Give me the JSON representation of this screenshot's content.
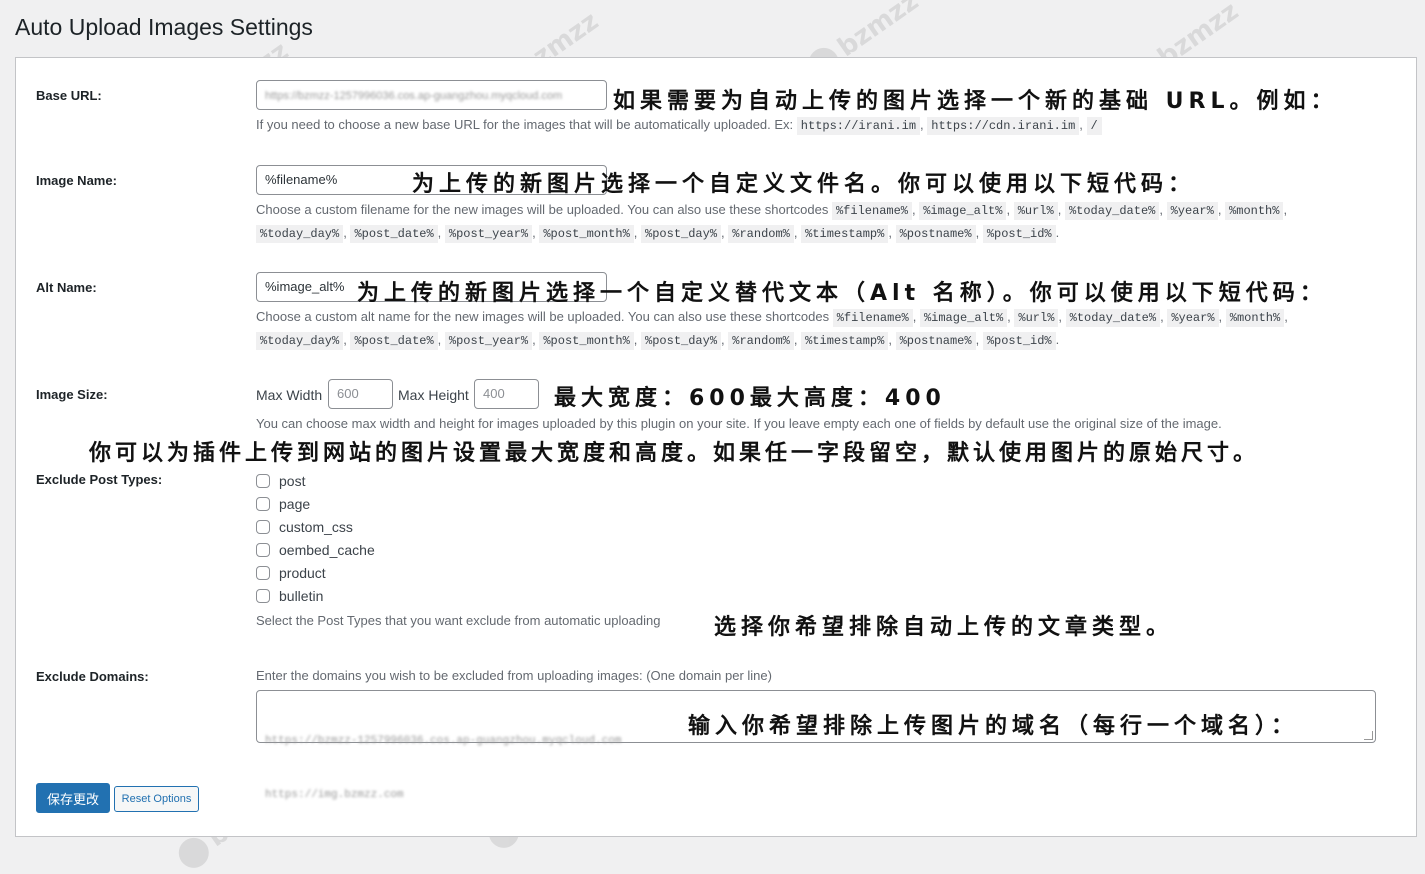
{
  "page": {
    "title": "Auto Upload Images Settings"
  },
  "base_url": {
    "label": "Base URL:",
    "value": "https://bzmzz-1257996036.cos.ap-guangzhou.myqcloud.com",
    "description": "If you need to choose a new base URL for the images that will be automatically uploaded. Ex:",
    "examples": [
      "https://irani.im",
      "https://cdn.irani.im",
      "/"
    ],
    "annotation": "如果需要为自动上传的图片选择一个新的基础 URL。例如："
  },
  "image_name": {
    "label": "Image Name:",
    "value": "%filename%",
    "description": "Choose a custom filename for the new images will be uploaded. You can also use these shortcodes",
    "annotation": "为上传的新图片选择一个自定义文件名。你可以使用以下短代码："
  },
  "alt_name": {
    "label": "Alt Name:",
    "value": "%image_alt%",
    "description": "Choose a custom alt name for the new images will be uploaded. You can also use these shortcodes",
    "annotation": "为上传的新图片选择一个自定义替代文本（Alt 名称）。你可以使用以下短代码："
  },
  "shortcodes": [
    "%filename%",
    "%image_alt%",
    "%url%",
    "%today_date%",
    "%year%",
    "%month%",
    "%today_day%",
    "%post_date%",
    "%post_year%",
    "%post_month%",
    "%post_day%",
    "%random%",
    "%timestamp%",
    "%postname%",
    "%post_id%"
  ],
  "image_size": {
    "label": "Image Size:",
    "max_width_label": "Max Width",
    "max_width_placeholder": "600",
    "max_height_label": "Max Height",
    "max_height_placeholder": "400",
    "description": "You can choose max width and height for images uploaded by this plugin on your site. If you leave empty each one of fields by default use the original size of the image.",
    "annotation_top": "最大宽度：600最大高度：400",
    "annotation_bottom": "你可以为插件上传到网站的图片设置最大宽度和高度。如果任一字段留空，默认使用图片的原始尺寸。"
  },
  "exclude_post_types": {
    "label": "Exclude Post Types:",
    "options": [
      "post",
      "page",
      "custom_css",
      "oembed_cache",
      "product",
      "bulletin"
    ],
    "description": "Select the Post Types that you want exclude from automatic uploading",
    "annotation": "选择你希望排除自动上传的文章类型。"
  },
  "exclude_domains": {
    "label": "Exclude Domains:",
    "description": "Enter the domains you wish to be excluded from uploading images: (One domain per line)",
    "lines": [
      "https://bzmzz-1257996036.cos.ap-guangzhou.myqcloud.com",
      "https://img.bzmzz.com"
    ],
    "annotation": "输入你希望排除上传图片的域名（每行一个域名）："
  },
  "buttons": {
    "save": "保存更改",
    "reset": "Reset Options"
  },
  "watermark": "bzmzz"
}
